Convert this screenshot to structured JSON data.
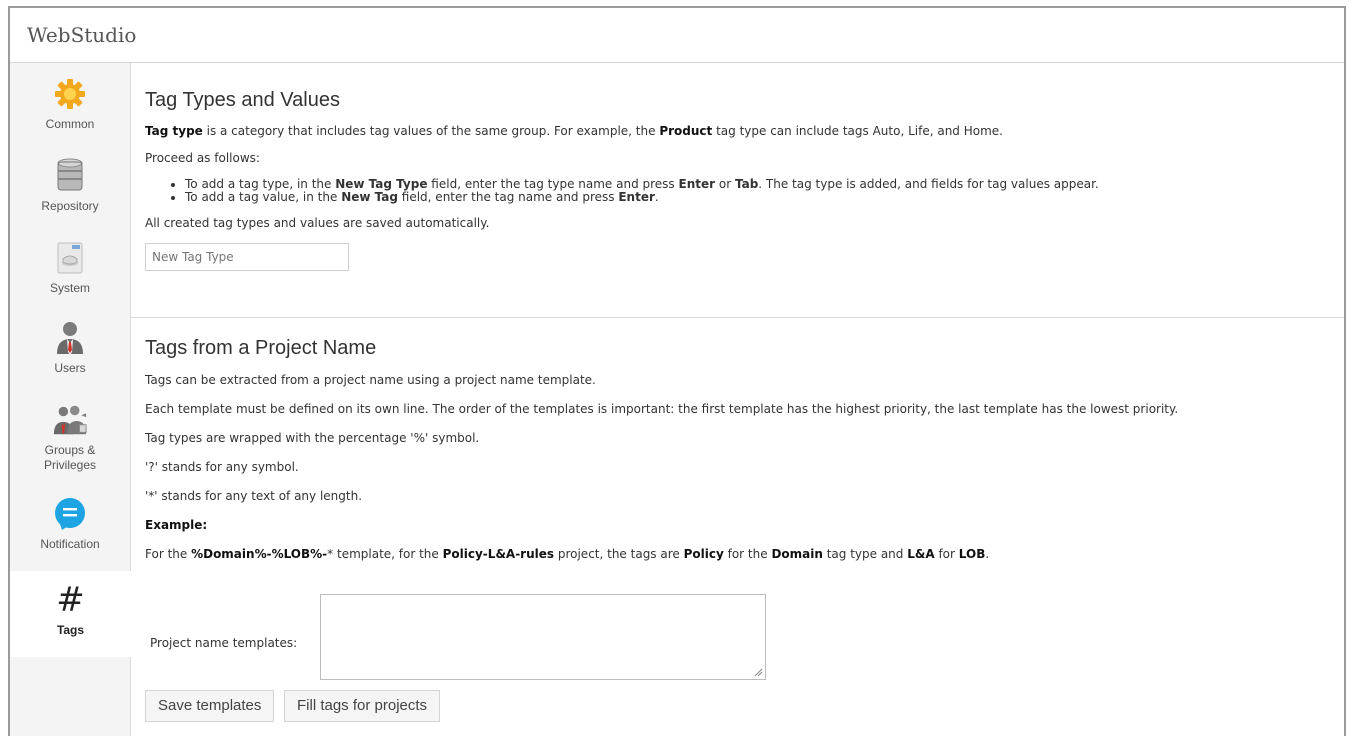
{
  "app": {
    "title": "WebStudio"
  },
  "sidebar": {
    "items": [
      {
        "label": "Common",
        "icon": "gear-icon"
      },
      {
        "label": "Repository",
        "icon": "database-icon"
      },
      {
        "label": "System",
        "icon": "system-icon"
      },
      {
        "label": "Users",
        "icon": "user-icon"
      },
      {
        "label_line1": "Groups &",
        "label_line2": "Privileges",
        "icon": "groups-icon"
      },
      {
        "label": "Notification",
        "icon": "notification-icon"
      },
      {
        "label": "Tags",
        "icon": "hash-icon",
        "glyph": "#",
        "active": true
      }
    ]
  },
  "tag_types": {
    "title": "Tag Types and Values",
    "intro_term": "Tag type",
    "intro_rest1": " is a category that includes tag values of the same group. For example, the ",
    "intro_product": "Product",
    "intro_rest2": " tag type can include tags Auto, Life, and Home.",
    "proceed": "Proceed as follows:",
    "bullet1_a": "To add a tag type, in the ",
    "bullet1_b": "New Tag Type",
    "bullet1_c": " field, enter the tag type name and press ",
    "bullet1_d": "Enter",
    "bullet1_e": " or ",
    "bullet1_f": "Tab",
    "bullet1_g": ". The tag type is added, and fields for tag values appear.",
    "bullet2_a": "To add a tag value, in the ",
    "bullet2_b": "New Tag",
    "bullet2_c": " field, enter the tag name and press ",
    "bullet2_d": "Enter",
    "bullet2_e": ".",
    "saved_note": "All created tag types and values are saved automatically.",
    "new_tag_type_placeholder": "New Tag Type"
  },
  "project_tags": {
    "title": "Tags from a Project Name",
    "line1": "Tags can be extracted from a project name using a project name template.",
    "line2": "Each template must be defined on its own line. The order of the templates is important: the first template has the highest priority, the last template has the lowest priority.",
    "line3": "Tag types are wrapped with the percentage '%' symbol.",
    "line4": "'?' stands for any symbol.",
    "line5": "'*' stands for any text of any length.",
    "example_label": "Example:",
    "ex_a": "For the ",
    "ex_b": "%Domain%-%LOB%-",
    "ex_c": "* template, for the ",
    "ex_d": "Policy-L&A-rules",
    "ex_e": " project, the tags are ",
    "ex_f": "Policy",
    "ex_g": " for the ",
    "ex_h": "Domain",
    "ex_i": " tag type and ",
    "ex_j": "L&A",
    "ex_k": " for ",
    "ex_l": "LOB",
    "ex_m": ".",
    "templates_label": "Project name templates:",
    "templates_value": "",
    "save_button": "Save templates",
    "fill_button": "Fill tags for projects"
  }
}
